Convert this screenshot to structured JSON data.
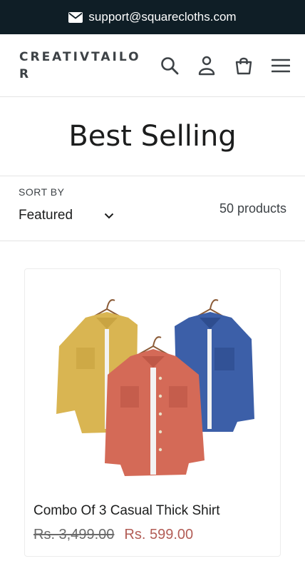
{
  "announcement": {
    "email": "support@squarecloths.com",
    "icon": "mail-icon"
  },
  "header": {
    "logo": "CREATIVTAILOR",
    "icons": [
      "search-icon",
      "account-icon",
      "cart-icon",
      "menu-icon"
    ]
  },
  "collection": {
    "title": "Best Selling",
    "sort_label": "SORT BY",
    "sort_value": "Featured",
    "product_count": "50 products"
  },
  "products": [
    {
      "title": "Combo Of 3 Casual Thick Shirt",
      "compare_price": "Rs. 3,499.00",
      "sale_price": "Rs. 599.00",
      "colors": [
        "#d9b552",
        "#3c5fa8",
        "#d46a57"
      ]
    }
  ],
  "colors": {
    "topbar": "#0f1e26",
    "sale_price": "#b25d56"
  }
}
